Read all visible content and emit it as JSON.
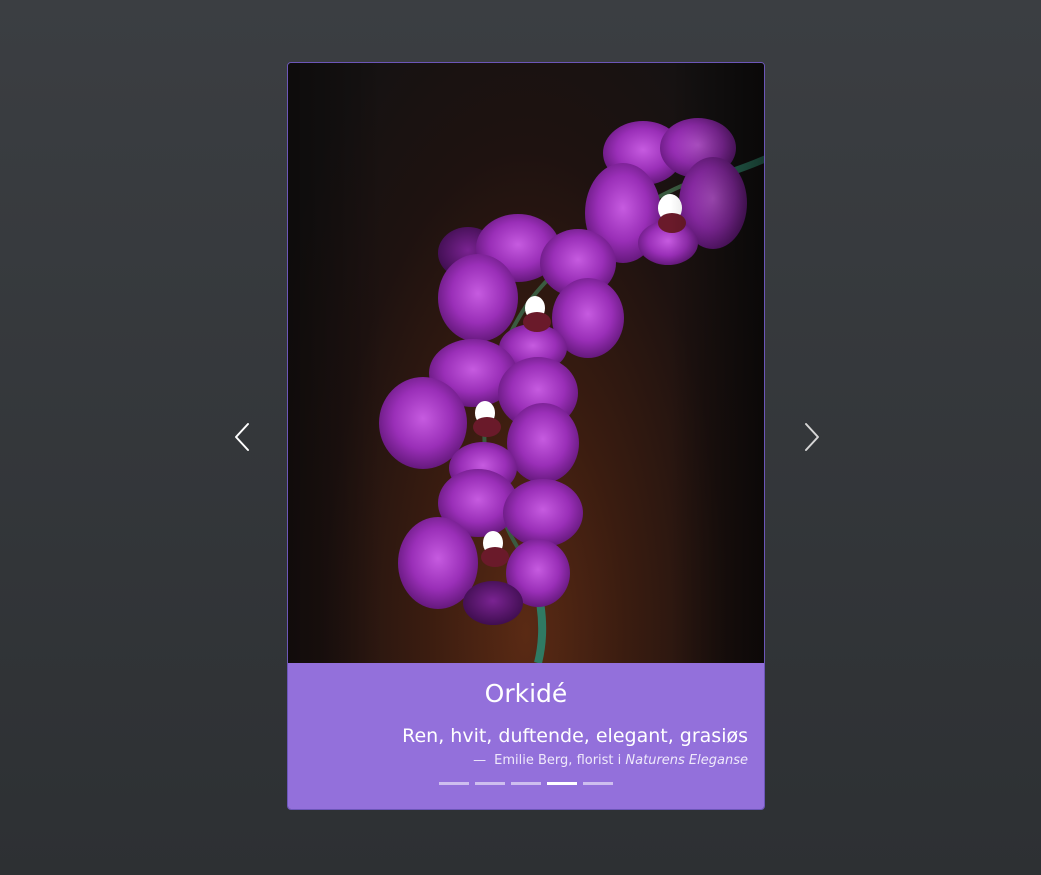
{
  "carousel": {
    "active_index": 3,
    "slide_count": 5,
    "title": "Orkidé",
    "quote": "Ren, hvit, duftende, elegant, grasiøs",
    "attribution_dash": "—",
    "attribution_author": "Emilie Berg, florist i",
    "attribution_source": "Naturens Eleganse"
  },
  "controls": {
    "prev_icon": "chevron-left-icon",
    "next_icon": "chevron-right-icon"
  },
  "colors": {
    "caption_bg": "#9370db",
    "page_bg": "#34373b",
    "flower": "#9a2fb8"
  }
}
